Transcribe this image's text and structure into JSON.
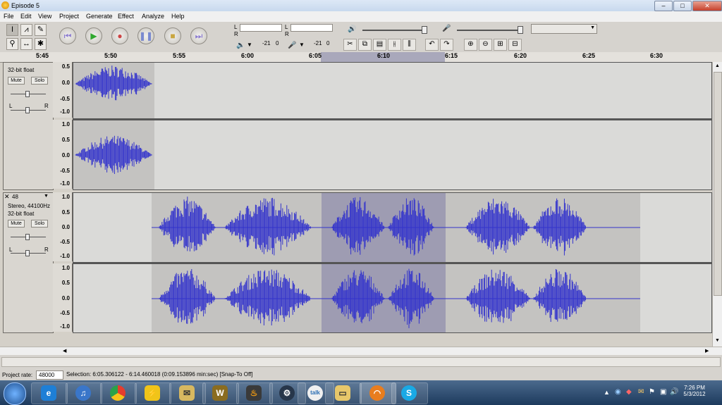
{
  "window": {
    "title": "Episode 5",
    "controls": {
      "minimize": "–",
      "maximize": "□",
      "close": "✕"
    }
  },
  "menu": [
    "File",
    "Edit",
    "View",
    "Project",
    "Generate",
    "Effect",
    "Analyze",
    "Help"
  ],
  "toolbar": {
    "tools": [
      "selection-tool-icon",
      "envelope-tool-icon",
      "draw-tool-icon",
      "zoom-tool-icon",
      "timeshift-tool-icon",
      "multi-tool-icon"
    ],
    "transport": [
      "skip-start-icon",
      "play-icon",
      "record-icon",
      "pause-icon",
      "stop-icon",
      "skip-end-icon"
    ],
    "meter_labels": {
      "left": "L",
      "right": "R"
    },
    "meter_db": [
      "-21",
      "0",
      "-21",
      "0"
    ],
    "edit_buttons": [
      "cut-icon",
      "copy-icon",
      "paste-icon",
      "trim-icon",
      "silence-icon",
      "undo-icon",
      "redo-icon",
      "zoom-in-icon",
      "zoom-out-icon",
      "fit-selection-icon",
      "fit-project-icon"
    ]
  },
  "ruler": {
    "ticks": [
      "5:45",
      "5:50",
      "5:55",
      "6:00",
      "6:05",
      "6:10",
      "6:15",
      "6:20",
      "6:25",
      "6:30"
    ]
  },
  "track1": {
    "info": "32-bit float",
    "mute": "Mute",
    "solo": "Solo",
    "pan_l": "L",
    "pan_r": "R",
    "scale_top": [
      "0.5",
      "0.0",
      "-0.5",
      "-1.0"
    ],
    "scale_bottom": [
      "1.0",
      "0.5",
      "0.0",
      "-0.5",
      "-1.0"
    ]
  },
  "track2": {
    "close": "✕",
    "name": "48",
    "format": "Stereo, 44100Hz",
    "info": "32-bit float",
    "mute": "Mute",
    "solo": "Solo",
    "pan_l": "L",
    "pan_r": "R",
    "scale": [
      "1.0",
      "0.5",
      "0.0",
      "-0.5",
      "-1.0"
    ]
  },
  "status": {
    "project_rate_label": "Project rate:",
    "project_rate_value": "48000",
    "selection": "Selection: 6:05.306122 - 6:14.460018 (0:09.153896 min:sec)  [Snap-To Off]"
  },
  "taskbar": {
    "start": "start-orb-icon",
    "apps": [
      "internet-explorer-icon",
      "itunes-icon",
      "chrome-icon",
      "winamp-icon",
      "folder-mail-icon",
      "world-of-warcraft-icon",
      "fraps-icon",
      "steam-icon",
      "gtalk-icon",
      "file-explorer-icon",
      "audacity-icon",
      "skype-icon"
    ],
    "time": "7:26 PM",
    "date": "5/3/2012"
  },
  "colors": {
    "waveform": "#3333cc",
    "selection": "#9e9cb2",
    "clip": "#c4c3c1"
  }
}
